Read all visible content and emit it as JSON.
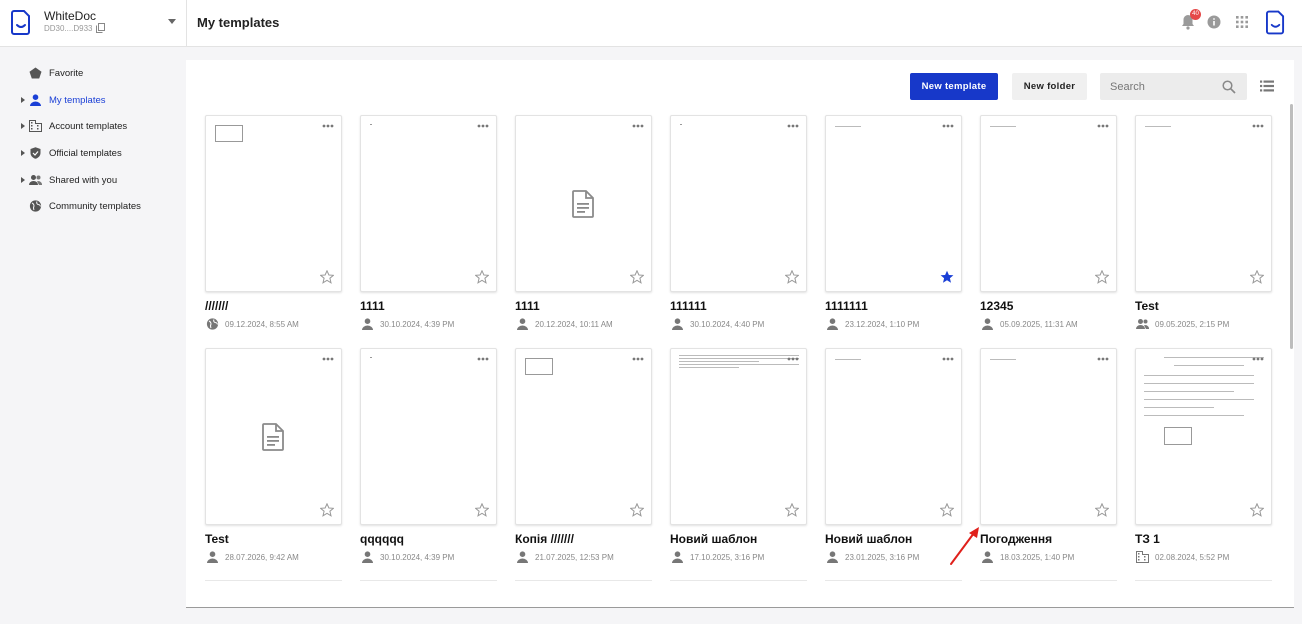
{
  "brand": {
    "name": "WhiteDoc",
    "id": "DD30....D933"
  },
  "header": {
    "title": "My templates",
    "notification_count": "40"
  },
  "sidebar": {
    "items": [
      {
        "label": "Favorite",
        "icon": "pentagon-icon",
        "expandable": false,
        "active": false
      },
      {
        "label": "My templates",
        "icon": "person-icon",
        "expandable": true,
        "active": true
      },
      {
        "label": "Account templates",
        "icon": "building-icon",
        "expandable": true,
        "active": false
      },
      {
        "label": "Official templates",
        "icon": "shield-icon",
        "expandable": true,
        "active": false
      },
      {
        "label": "Shared with you",
        "icon": "people-icon",
        "expandable": true,
        "active": false
      },
      {
        "label": "Community templates",
        "icon": "globe-icon",
        "expandable": false,
        "active": false
      }
    ]
  },
  "toolbar": {
    "new_template_label": "New template",
    "new_folder_label": "New folder",
    "search_placeholder": "Search"
  },
  "templates": [
    {
      "title": "///////",
      "date": "09.12.2024, 8:55 AM",
      "owner_icon": "globe-icon",
      "favorite": false,
      "preview": "box"
    },
    {
      "title": "1111",
      "date": "30.10.2024, 4:39 PM",
      "owner_icon": "person-icon",
      "favorite": false,
      "preview": "dot"
    },
    {
      "title": "1111",
      "date": "20.12.2024, 10:11 AM",
      "owner_icon": "person-icon",
      "favorite": false,
      "preview": "doc"
    },
    {
      "title": "111111",
      "date": "30.10.2024, 4:40 PM",
      "owner_icon": "person-icon",
      "favorite": false,
      "preview": "dot"
    },
    {
      "title": "1111111",
      "date": "23.12.2024, 1:10 PM",
      "owner_icon": "person-icon",
      "favorite": true,
      "preview": "line"
    },
    {
      "title": "12345",
      "date": "05.09.2025, 11:31 AM",
      "owner_icon": "person-icon",
      "favorite": false,
      "preview": "line"
    },
    {
      "title": "Test",
      "date": "09.05.2025, 2:15 PM",
      "owner_icon": "people-icon",
      "favorite": false,
      "preview": "line"
    },
    {
      "title": "Test",
      "date": "28.07.2026, 9:42 AM",
      "owner_icon": "person-icon",
      "favorite": false,
      "preview": "doc"
    },
    {
      "title": "qqqqqq",
      "date": "30.10.2024, 4:39 PM",
      "owner_icon": "person-icon",
      "favorite": false,
      "preview": "dot"
    },
    {
      "title": "Копія ///////",
      "date": "21.07.2025, 12:53 PM",
      "owner_icon": "person-icon",
      "favorite": false,
      "preview": "box"
    },
    {
      "title": "Новий шаблон",
      "date": "17.10.2025, 3:16 PM",
      "owner_icon": "person-icon",
      "favorite": false,
      "preview": "table"
    },
    {
      "title": "Новий шаблон",
      "date": "23.01.2025, 3:16 PM",
      "owner_icon": "person-icon",
      "favorite": false,
      "preview": "line"
    },
    {
      "title": "Погодження",
      "date": "18.03.2025, 1:40 PM",
      "owner_icon": "person-icon",
      "favorite": false,
      "preview": "line"
    },
    {
      "title": "ТЗ 1",
      "date": "02.08.2024, 5:52 PM",
      "owner_icon": "building-icon",
      "favorite": false,
      "preview": "form"
    }
  ],
  "colors": {
    "accent": "#1738c9",
    "favorite_star": "#1a3fd6",
    "badge": "#e54848",
    "annotation_arrow": "#e0201b"
  }
}
